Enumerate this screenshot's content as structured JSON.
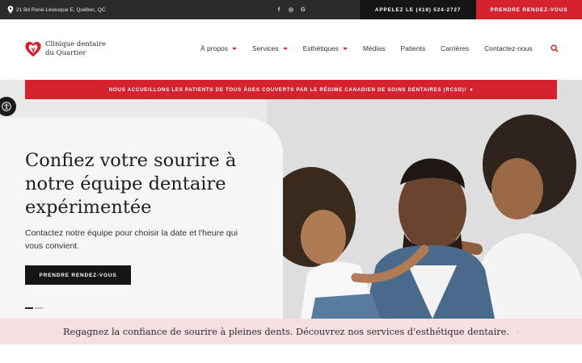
{
  "topbar": {
    "address": "21 Bd René-Lévesque E, Québec, QC",
    "social": [
      {
        "icon": "facebook-icon",
        "glyph": "f"
      },
      {
        "icon": "instagram-icon",
        "glyph": "◎"
      },
      {
        "icon": "google-icon",
        "glyph": "G"
      }
    ],
    "phone_label": "APPELEZ LE (418) 524-2727",
    "appointment_label": "PRENDRE RENDEZ-VOUS"
  },
  "header": {
    "logo_line1": "Clinique dentaire",
    "logo_line2": "du Quartier",
    "nav": [
      {
        "label": "À propos",
        "dropdown": true
      },
      {
        "label": "Services",
        "dropdown": true
      },
      {
        "label": "Esthétiques",
        "dropdown": true
      },
      {
        "label": "Médias",
        "dropdown": false
      },
      {
        "label": "Patients",
        "dropdown": false
      },
      {
        "label": "Carrières",
        "dropdown": false
      },
      {
        "label": "Contactez-nous",
        "dropdown": false
      }
    ]
  },
  "hero": {
    "banner": "NOUS ACCUEILLONS LES PATIENTS DE TOUS ÂGES COUVERTS PAR LE RÉGIME CANADIEN DE SOINS DENTAIRES (RCSD)!",
    "headline_line1": "Confiez votre sourire à",
    "headline_line2": "notre équipe dentaire",
    "headline_line3": "expérimentée",
    "subtext": "Contactez notre équipe pour choisir la date et l'heure qui vous convient.",
    "cta_label": "PRENDRE RENDEZ-VOUS",
    "slide_active": 1,
    "slide_count": 2
  },
  "promo": {
    "text": "Regagnez la confiance de sourire à pleines dents. Découvrez nos services d'esthétique dentaire.",
    "chevron": "›"
  },
  "colors": {
    "brand_red": "#d6222f",
    "dark": "#151515",
    "topbar_bg": "#2b2b2b",
    "promo_bg": "#f6dfe2"
  }
}
